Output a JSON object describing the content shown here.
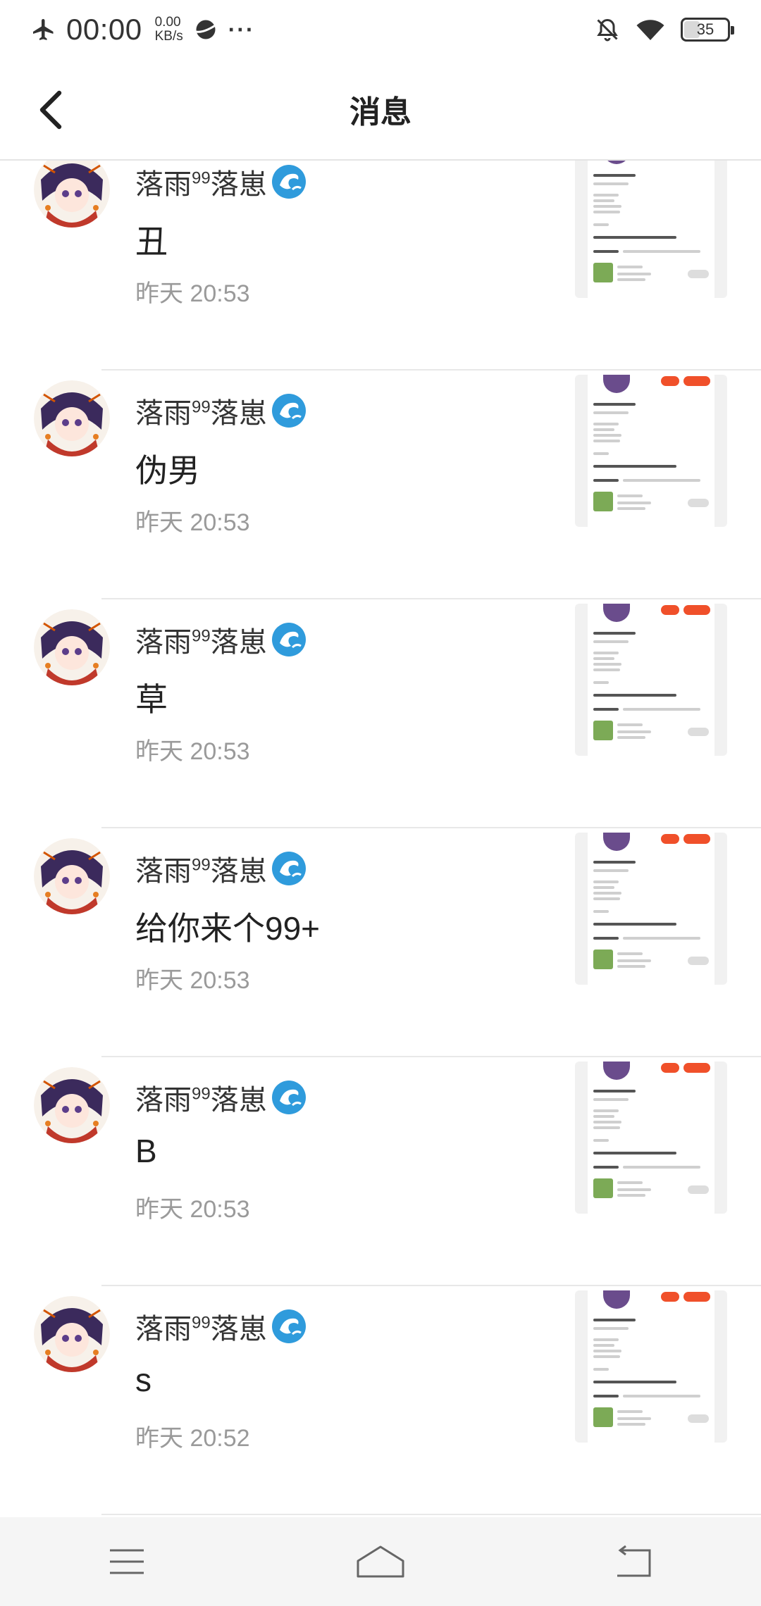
{
  "status_bar": {
    "time": "00:00",
    "speed_value": "0.00",
    "speed_unit": "KB/s",
    "more": "···",
    "battery": "35",
    "icons": [
      "airplane-icon",
      "planet-icon",
      "bell-off-icon",
      "wifi-icon",
      "battery-icon"
    ]
  },
  "header": {
    "title": "消息",
    "back_icon": "chevron-left-icon"
  },
  "messages": [
    {
      "name": "落雨",
      "sup": "99",
      "name_tail": "落崽",
      "badge": "dolphin-icon",
      "text": "丑",
      "time": "昨天 20:53"
    },
    {
      "name": "落雨",
      "sup": "99",
      "name_tail": "落崽",
      "badge": "dolphin-icon",
      "text": "伪男",
      "time": "昨天 20:53"
    },
    {
      "name": "落雨",
      "sup": "99",
      "name_tail": "落崽",
      "badge": "dolphin-icon",
      "text": "草",
      "time": "昨天 20:53"
    },
    {
      "name": "落雨",
      "sup": "99",
      "name_tail": "落崽",
      "badge": "dolphin-icon",
      "text": "给你来个99+",
      "time": "昨天 20:53"
    },
    {
      "name": "落雨",
      "sup": "99",
      "name_tail": "落崽",
      "badge": "dolphin-icon",
      "text": "B",
      "time": "昨天 20:53"
    },
    {
      "name": "落雨",
      "sup": "99",
      "name_tail": "落崽",
      "badge": "dolphin-icon",
      "text": "s",
      "time": "昨天 20:52"
    }
  ],
  "nav": {
    "icons": [
      "menu-icon",
      "home-icon",
      "back-icon"
    ]
  },
  "colors": {
    "accent": "#f0502a",
    "dolphin": "#2f9bdc",
    "time_text": "#9a9a9a",
    "divider": "#e8e8e8",
    "nav_bg": "#f5f5f5"
  }
}
